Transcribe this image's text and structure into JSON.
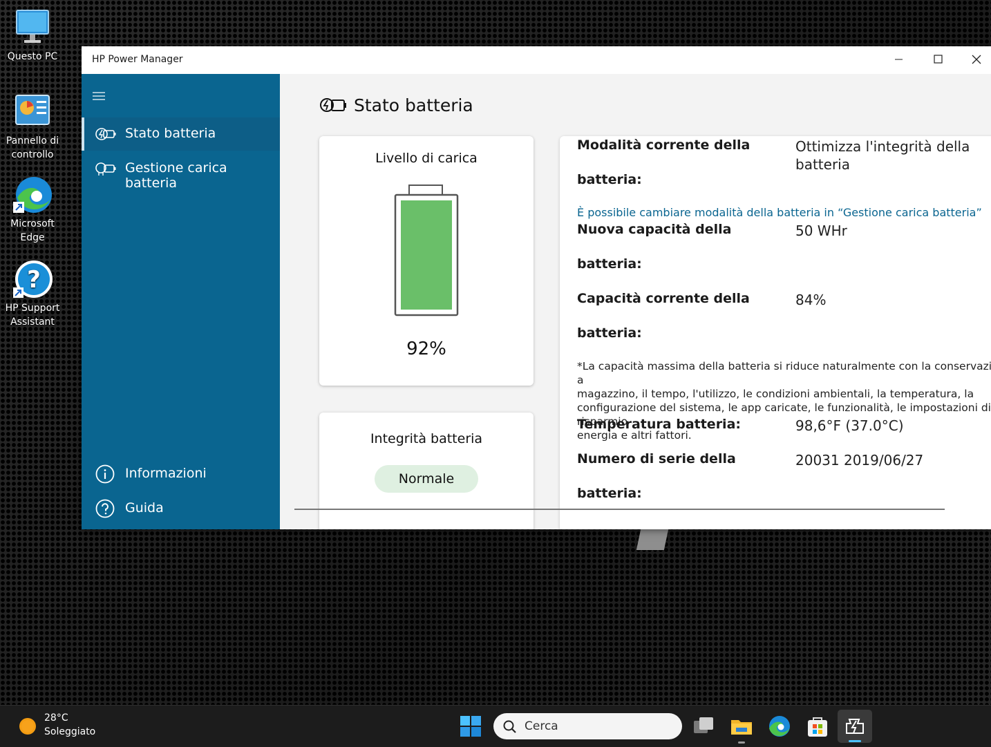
{
  "desktop": {
    "icons": [
      {
        "label": "Questo PC",
        "icon": "monitor-icon"
      },
      {
        "label": "Pannello di controllo",
        "icon": "control-panel-icon"
      },
      {
        "label": "Microsoft Edge",
        "icon": "edge-icon"
      },
      {
        "label": "HP Support Assistant",
        "icon": "help-icon"
      }
    ]
  },
  "window": {
    "title": "HP Power Manager",
    "controls": {
      "minimize": "minimize-icon",
      "maximize": "maximize-icon",
      "close": "close-icon"
    }
  },
  "sidebar": {
    "menu_icon": "hamburger-icon",
    "items": [
      {
        "label": "Stato batteria",
        "icon": "battery-status-icon",
        "selected": true
      },
      {
        "label": "Gestione carica batteria",
        "icon": "battery-charge-icon",
        "selected": false
      }
    ],
    "bottom_items": [
      {
        "label": "Informazioni",
        "icon": "info-icon"
      },
      {
        "label": "Guida",
        "icon": "help-icon"
      }
    ]
  },
  "main": {
    "title": "Stato batteria",
    "charge_card": {
      "title": "Livello di carica",
      "level_label": "92%",
      "level_fraction": 0.92
    },
    "health_card": {
      "title": "Integrità batteria",
      "status": "Normale"
    },
    "details": {
      "mode_label_line1": "Modalità corrente della",
      "mode_label_line2": "batteria:",
      "mode_value_line1": "Ottimizza l'integrità della",
      "mode_value_line2": "batteria",
      "mode_link": "È possibile cambiare modalità della batteria in “Gestione carica batteria”",
      "new_capacity_label_line1": "Nuova capacità della",
      "new_capacity_label_line2": "batteria:",
      "new_capacity_value": "50 WHr",
      "current_capacity_label_line1": "Capacità corrente della",
      "current_capacity_label_line2": "batteria:",
      "current_capacity_value": "84%",
      "note": "*La capacità massima della batteria si riduce naturalmente con la conservazione a\nmagazzino, il tempo, l'utilizzo, le condizioni ambientali, la temperatura, la\nconfigurazione del sistema, le app caricate, le funzionalità, le impostazioni di risparmio\nenergia e altri fattori.",
      "temperature_label": "Temperatura batteria:",
      "temperature_value": "98,6°F (37.0°C)",
      "serial_label_line1": "Numero di serie della",
      "serial_label_line2": "batteria:",
      "serial_value": "20031 2019/06/27"
    }
  },
  "taskbar": {
    "weather_temp": "28°C",
    "weather_desc": "Soleggiato",
    "search_placeholder": "Cerca",
    "apps": [
      "windows-start-icon",
      "task-view-icon",
      "file-explorer-icon",
      "edge-icon",
      "store-icon",
      "hp-power-manager-icon"
    ]
  },
  "colors": {
    "sidebar": "#0a6590",
    "battery_fill": "#6abf69",
    "badge": "#dff0e1",
    "link": "#0a6590"
  }
}
